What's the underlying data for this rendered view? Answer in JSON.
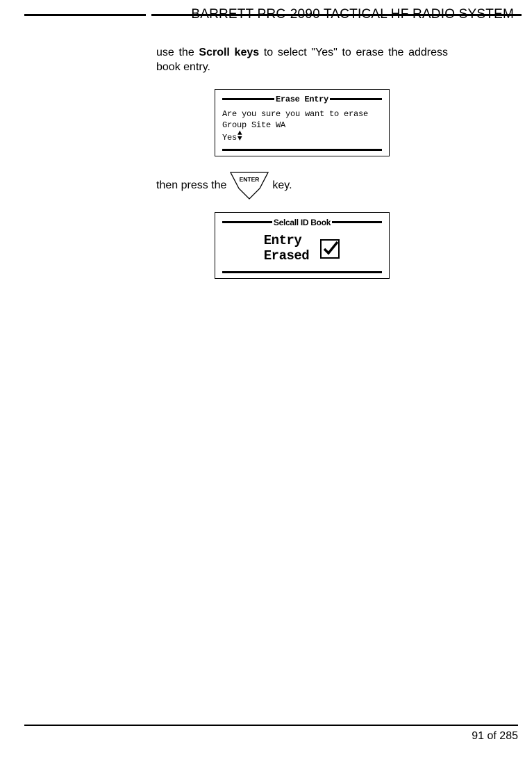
{
  "header": {
    "title": "BARRETT PRC-2090 TACTICAL HF RADIO SYSTEM"
  },
  "body": {
    "para1_pre": "use the ",
    "para1_bold": "Scroll keys",
    "para1_post": " to select \"Yes\" to erase the address book entry.",
    "para2_pre": "then press the ",
    "para2_post": " key."
  },
  "enter_key": {
    "label": "ENTER"
  },
  "lcd1": {
    "title": "Erase Entry",
    "line1": "Are you sure you want to erase",
    "line2": "Group Site WA",
    "line3": "Yes"
  },
  "lcd2": {
    "title": "Selcall ID Book",
    "line1": "Entry",
    "line2": "Erased"
  },
  "footer": {
    "page_num": "91 of 285"
  }
}
